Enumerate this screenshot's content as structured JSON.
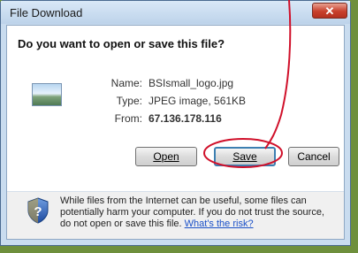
{
  "dialog": {
    "title": "File Download",
    "close_symbol": "✕",
    "question": "Do you want to open or save this file?",
    "file": {
      "icon": "image-file-icon",
      "name_label": "Name:",
      "name_value": "BSIsmall_logo.jpg",
      "type_label": "Type:",
      "type_value": "JPEG image, 561KB",
      "from_label": "From:",
      "from_value": "67.136.178.116"
    },
    "buttons": {
      "open": "Open",
      "save": "Save",
      "cancel": "Cancel"
    },
    "warning": {
      "icon": "shield-question-icon",
      "text": "While files from the Internet can be useful, some files can potentially harm your computer. If you do not trust the source, do not open or save this file.",
      "link": "What's the risk?"
    }
  },
  "colors": {
    "annotation": "#d0102a",
    "background": "#6e8f3c",
    "link": "#1a50c8"
  }
}
